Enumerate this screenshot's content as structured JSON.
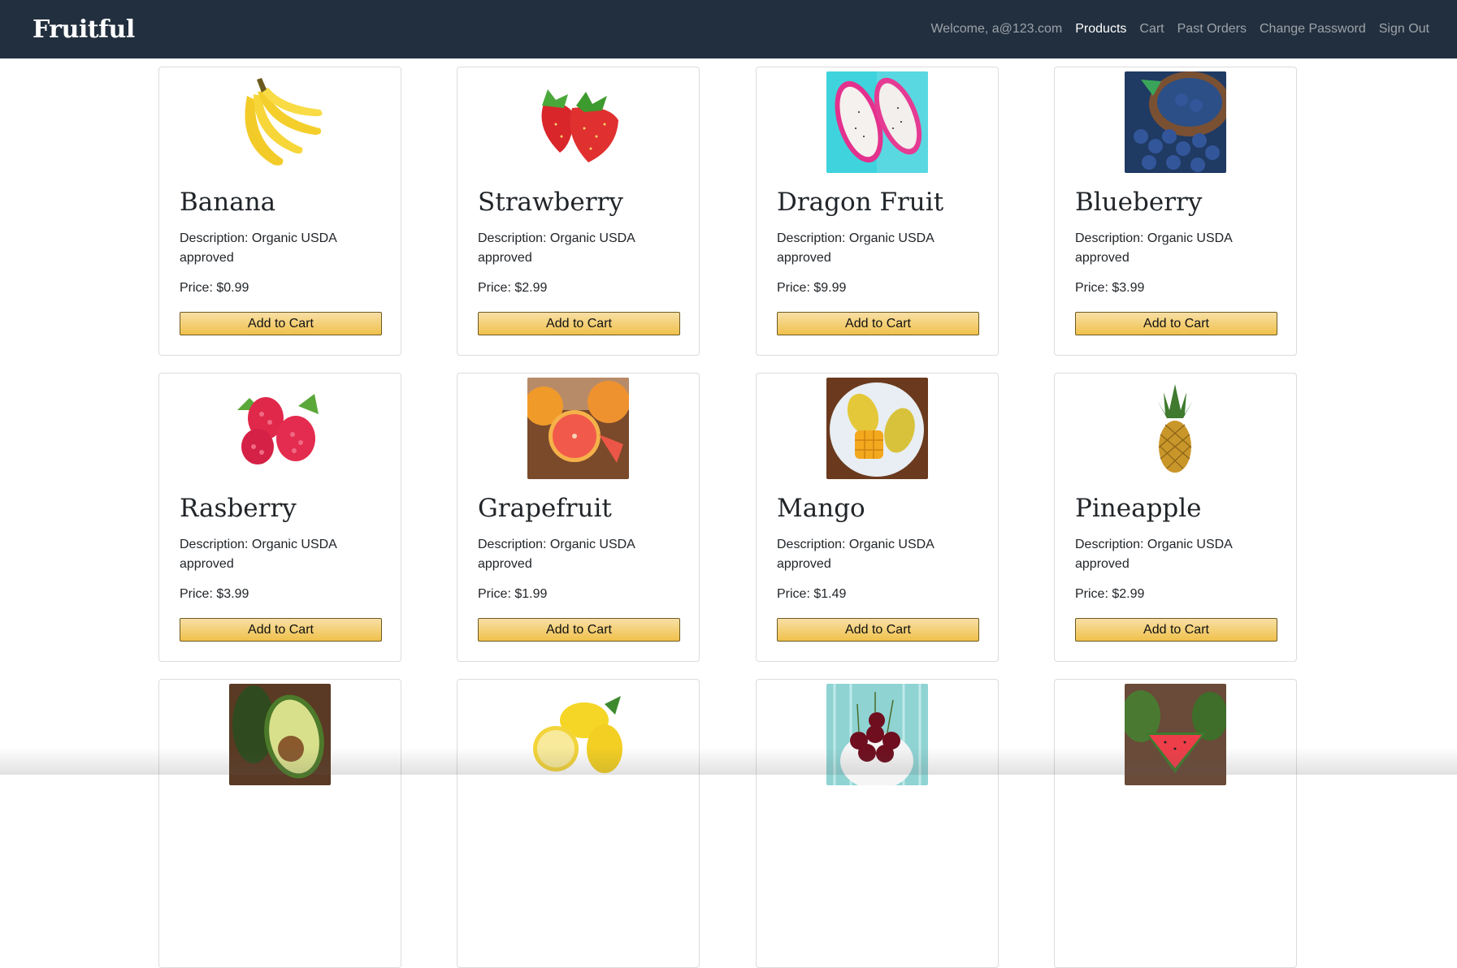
{
  "navbar": {
    "brand": "Fruitful",
    "welcome": "Welcome, a@123.com",
    "links": [
      "Products",
      "Cart",
      "Past Orders",
      "Change Password",
      "Sign Out"
    ]
  },
  "products": [
    {
      "name": "Banana",
      "description": "Description: Organic USDA approved",
      "price": "Price: $0.99",
      "button": "Add to Cart",
      "image": "banana-image"
    },
    {
      "name": "Strawberry",
      "description": "Description: Organic USDA approved",
      "price": "Price: $2.99",
      "button": "Add to Cart",
      "image": "strawberry-image"
    },
    {
      "name": "Dragon Fruit",
      "description": "Description: Organic USDA approved",
      "price": "Price: $9.99",
      "button": "Add to Cart",
      "image": "dragon-fruit-image"
    },
    {
      "name": "Blueberry",
      "description": "Description: Organic USDA approved",
      "price": "Price: $3.99",
      "button": "Add to Cart",
      "image": "blueberry-image"
    },
    {
      "name": "Rasberry",
      "description": "Description: Organic USDA approved",
      "price": "Price: $3.99",
      "button": "Add to Cart",
      "image": "raspberry-image"
    },
    {
      "name": "Grapefruit",
      "description": "Description: Organic USDA approved",
      "price": "Price: $1.99",
      "button": "Add to Cart",
      "image": "grapefruit-image"
    },
    {
      "name": "Mango",
      "description": "Description: Organic USDA approved",
      "price": "Price: $1.49",
      "button": "Add to Cart",
      "image": "mango-image"
    },
    {
      "name": "Pineapple",
      "description": "Description: Organic USDA approved",
      "price": "Price: $2.99",
      "button": "Add to Cart",
      "image": "pineapple-image"
    },
    {
      "image": "avocado-image"
    },
    {
      "image": "lemon-image"
    },
    {
      "image": "cherry-image"
    },
    {
      "image": "watermelon-image"
    }
  ]
}
